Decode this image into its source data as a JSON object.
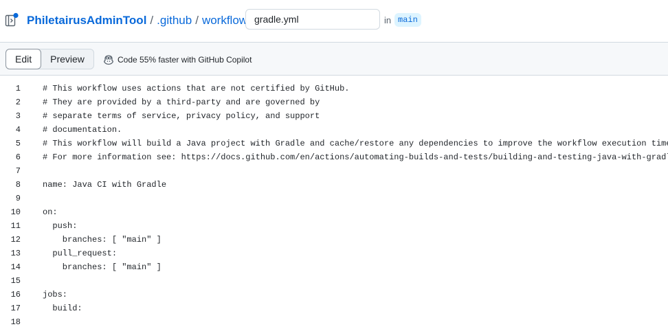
{
  "breadcrumb": {
    "repo": "PhiletairusAdminTool",
    "parts": [
      ".github",
      "workflows"
    ],
    "separator": "/"
  },
  "file": {
    "name_value": "gradle.yml"
  },
  "branch": {
    "in_label": "in",
    "name": "main"
  },
  "toolbar": {
    "edit_label": "Edit",
    "preview_label": "Preview",
    "copilot_label": "Code 55% faster with GitHub Copilot"
  },
  "editor": {
    "lines": [
      {
        "n": "1",
        "text": "# This workflow uses actions that are not certified by GitHub."
      },
      {
        "n": "2",
        "text": "# They are provided by a third-party and are governed by"
      },
      {
        "n": "3",
        "text": "# separate terms of service, privacy policy, and support"
      },
      {
        "n": "4",
        "text": "# documentation."
      },
      {
        "n": "5",
        "text": "# This workflow will build a Java project with Gradle and cache/restore any dependencies to improve the workflow execution time"
      },
      {
        "n": "6",
        "text": "# For more information see: https://docs.github.com/en/actions/automating-builds-and-tests/building-and-testing-java-with-gradle"
      },
      {
        "n": "7",
        "text": ""
      },
      {
        "n": "8",
        "text": "name: Java CI with Gradle"
      },
      {
        "n": "9",
        "text": ""
      },
      {
        "n": "10",
        "text": "on:"
      },
      {
        "n": "11",
        "text": "  push:"
      },
      {
        "n": "12",
        "text": "    branches: [ \"main\" ]"
      },
      {
        "n": "13",
        "text": "  pull_request:"
      },
      {
        "n": "14",
        "text": "    branches: [ \"main\" ]"
      },
      {
        "n": "15",
        "text": ""
      },
      {
        "n": "16",
        "text": "jobs:"
      },
      {
        "n": "17",
        "text": "  build:"
      },
      {
        "n": "18",
        "text": ""
      }
    ]
  },
  "colors": {
    "link": "#0969da",
    "toolbar_bg": "#f6f8fa",
    "branch_bg": "#ddf4ff",
    "notification_dot": "#0969da"
  }
}
